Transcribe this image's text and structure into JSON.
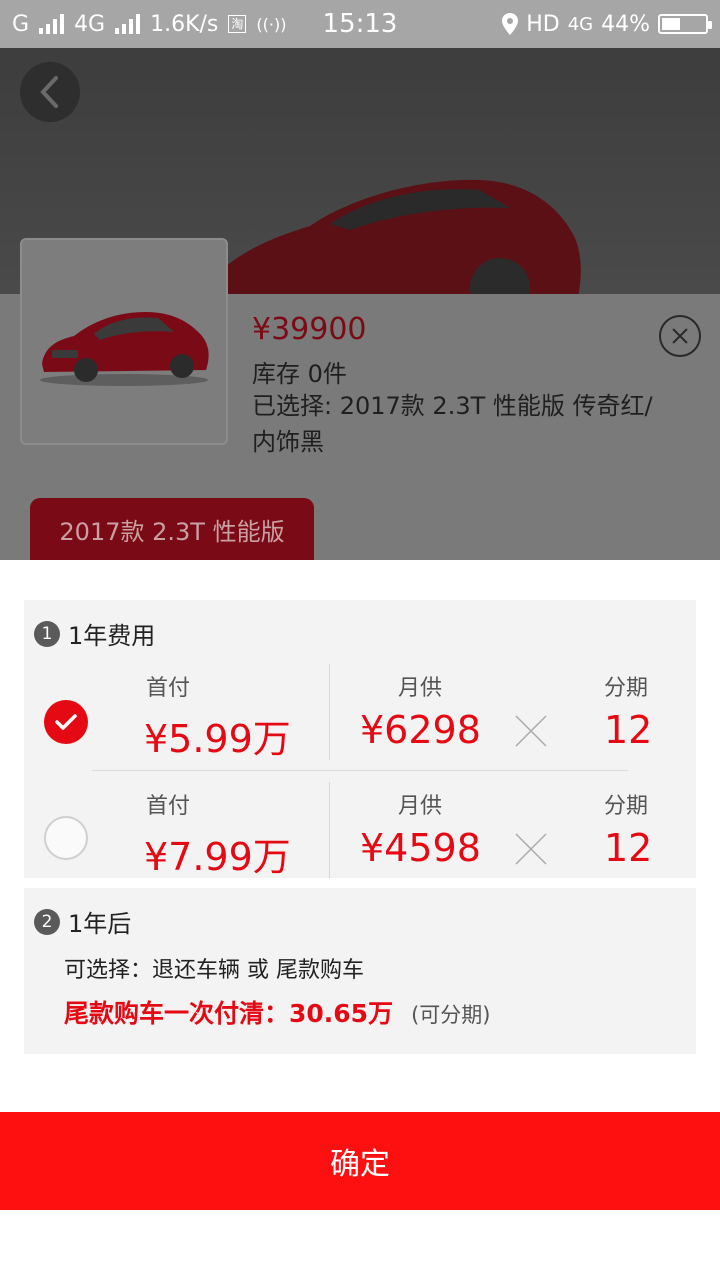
{
  "status_bar": {
    "carrier": "G",
    "network": "4G",
    "speed": "1.6K/s",
    "time": "15:13",
    "hd": "HD",
    "net2": "4G",
    "battery": "44%",
    "battery_level": 0.44
  },
  "product": {
    "price": "¥39900",
    "stock": "库存 0件",
    "selected": "已选择: 2017款 2.3T 性能版   传奇红/内饰黑",
    "version_chip": "2017款 2.3T 性能版"
  },
  "plan_section": {
    "number": "1",
    "title": "1年费用",
    "options": [
      {
        "down_label": "首付",
        "down_value": "¥5.99万",
        "monthly_label": "月供",
        "monthly_value": "¥6298",
        "periods_label": "分期",
        "periods_value": "12",
        "selected": true
      },
      {
        "down_label": "首付",
        "down_value": "¥7.99万",
        "monthly_label": "月供",
        "monthly_value": "¥4598",
        "periods_label": "分期",
        "periods_value": "12",
        "selected": false
      }
    ]
  },
  "after_section": {
    "number": "2",
    "title": "1年后",
    "choices": "可选择：退还车辆 或 尾款购车",
    "balloon": "尾款购车一次付清：30.65万",
    "installment_note": "(可分期)"
  },
  "confirm_label": "确定",
  "colors": {
    "accent": "#e50914",
    "confirm": "#ff1010",
    "dim_red": "#7a0b16"
  }
}
